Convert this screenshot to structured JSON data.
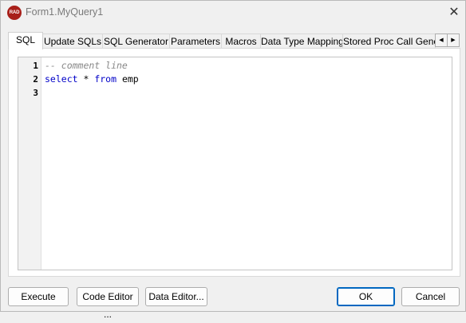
{
  "window": {
    "title": "Form1.MyQuery1",
    "icon_text": "RAD",
    "close_glyph": "✕"
  },
  "tabs": [
    {
      "label": "SQL",
      "active": true
    },
    {
      "label": "Update SQLs"
    },
    {
      "label": "SQL Generator"
    },
    {
      "label": "Parameters"
    },
    {
      "label": "Macros"
    },
    {
      "label": "Data Type Mapping"
    },
    {
      "label": "Stored Proc Call Gener"
    }
  ],
  "tab_scroll": {
    "left_glyph": "◀",
    "right_glyph": "▶"
  },
  "editor": {
    "line_numbers": [
      "1",
      "2",
      "3"
    ],
    "lines": {
      "l1": {
        "comment": "-- comment line"
      },
      "l2": {
        "kw1": "select",
        "t1": " * ",
        "kw2": "from",
        "t2": " emp"
      }
    }
  },
  "buttons": {
    "execute": "Execute",
    "code_editor": "Code Editor ...",
    "data_editor": "Data Editor...",
    "ok": "OK",
    "cancel": "Cancel"
  },
  "colors": {
    "keyword": "#0000c8",
    "comment": "#888888",
    "icon_bg": "#a8201a",
    "default_button_border": "#0067c0"
  }
}
